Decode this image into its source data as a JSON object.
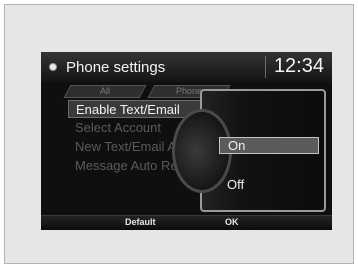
{
  "header": {
    "title": "Phone settings",
    "clock": "12:34"
  },
  "tabs": [
    {
      "label": "All"
    },
    {
      "label": "Phone"
    }
  ],
  "menu": {
    "items": [
      {
        "label": "Enable Text/Email",
        "state": "selected"
      },
      {
        "label": "Select Account",
        "state": "disabled"
      },
      {
        "label": "New Text/Email Alert",
        "state": "disabled"
      },
      {
        "label": "Message Auto Reading",
        "state": "disabled"
      }
    ]
  },
  "popup": {
    "options": [
      {
        "label": "On",
        "highlighted": true
      },
      {
        "label": "Off",
        "highlighted": false
      }
    ]
  },
  "footer": {
    "default_label": "Default",
    "ok_label": "OK"
  }
}
